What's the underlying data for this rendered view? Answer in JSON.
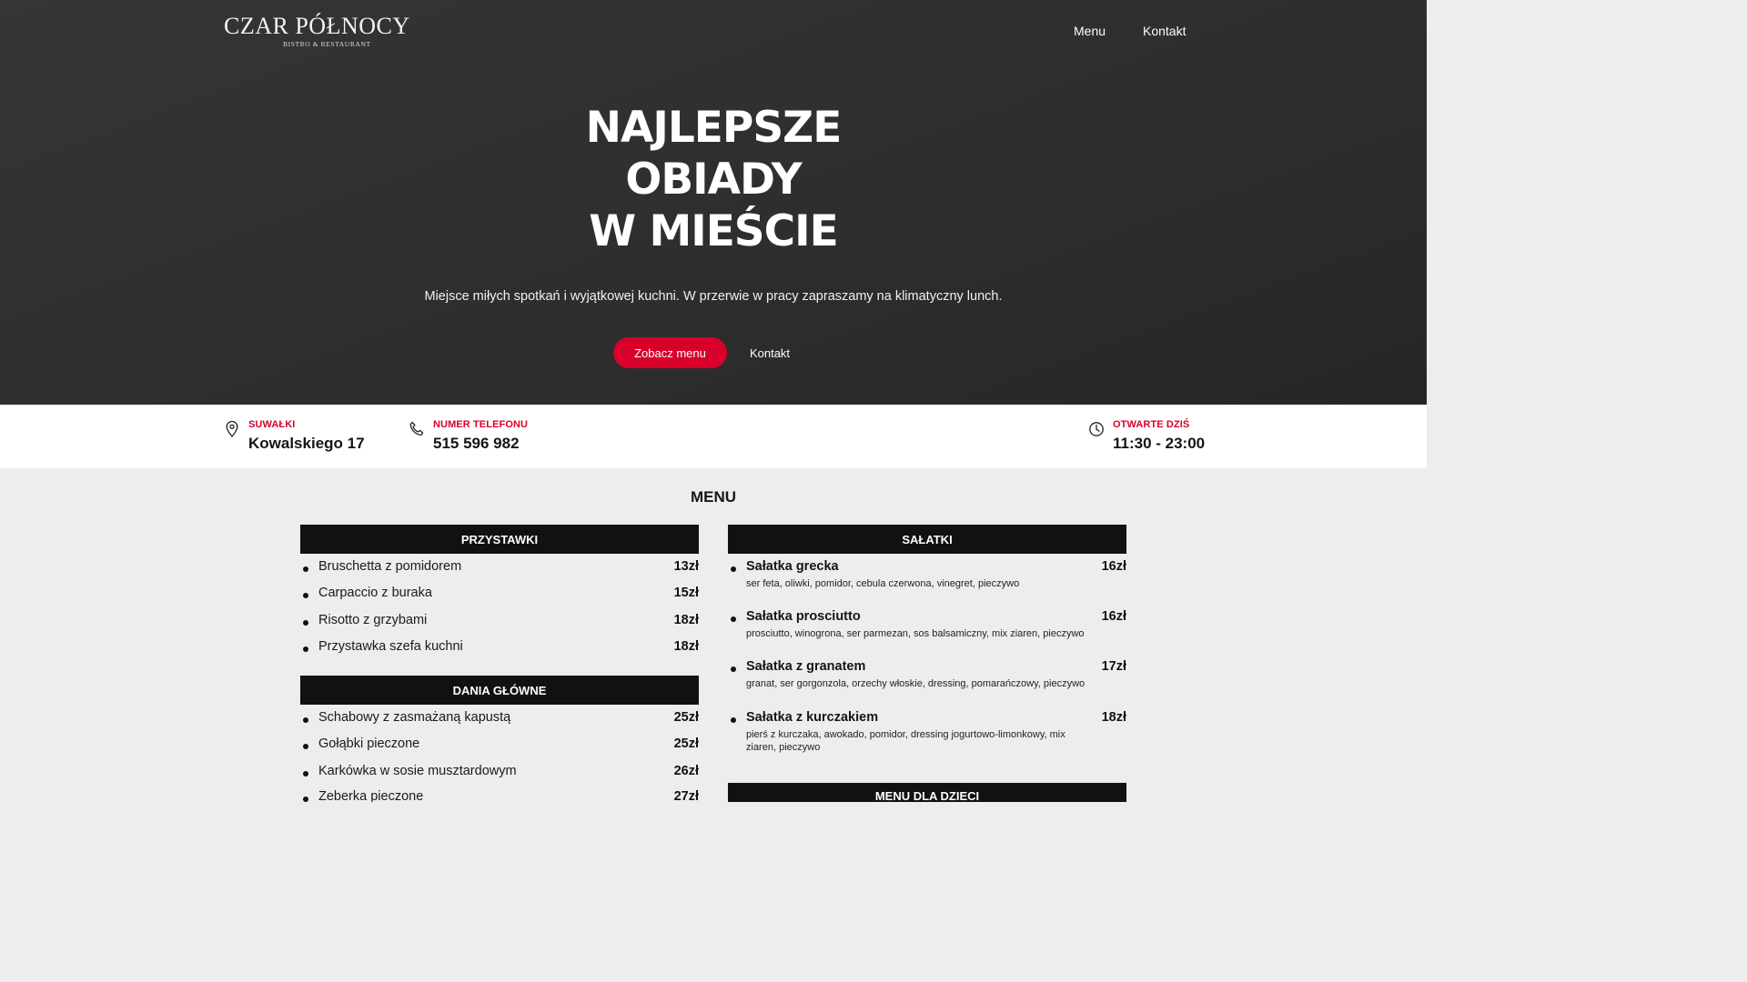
{
  "brand": {
    "name": "CZAR PÓŁNOCY",
    "tagline": "BISTRO & RESTAURANT"
  },
  "nav": {
    "menu": "Menu",
    "contact": "Kontakt"
  },
  "hero": {
    "title_lines": [
      "NAJLEPSZE",
      "OBIADY",
      "W MIEŚCIE"
    ],
    "subtitle": "Miejsce miłych spotkań i wyjątkowej kuchni. W przerwie w pracy zapraszamy na klimatyczny lunch.",
    "primary_button": "Zobacz menu",
    "secondary_button": "Kontakt"
  },
  "info": {
    "address_label": "SUWAŁKI",
    "address_value": "Kowalskiego 17",
    "phone_label": "NUMER TELEFONU",
    "phone_value": "515 596 982",
    "hours_label": "OTWARTE DZIŚ",
    "hours_value": "11:30 - 23:00",
    "icons": [
      "location-pin-icon",
      "phone-icon",
      "clock-icon"
    ]
  },
  "menu": {
    "heading": "MENU",
    "starters": {
      "title": "PRZYSTAWKI",
      "items": [
        {
          "name": "Bruschetta z pomidorem",
          "price": "13zł"
        },
        {
          "name": "Carpaccio z buraka",
          "price": "15zł"
        },
        {
          "name": "Risotto z grzybami",
          "price": "18zł"
        },
        {
          "name": "Przystawka szefa kuchni",
          "price": "18zł"
        }
      ]
    },
    "mains": {
      "title": "DANIA GŁÓWNE",
      "items": [
        {
          "name": "Schabowy z zasmażaną kapustą",
          "price": "25zł"
        },
        {
          "name": "Gołąbki pieczone",
          "price": "25zł"
        },
        {
          "name": "Karkówka w sosie musztardowym",
          "price": "26zł"
        },
        {
          "name": "Żeberka pieczone",
          "price": "27zł"
        }
      ]
    },
    "salads": {
      "title": "SAŁATKI",
      "items": [
        {
          "name": "Sałatka grecka",
          "price": "16zł",
          "desc": "ser feta, oliwki, pomidor, cebula czerwona, vinegret, pieczywo"
        },
        {
          "name": "Sałatka prosciutto",
          "price": "16zł",
          "desc": "prosciutto, winogrona, ser parmezan, sos balsamiczny, mix ziaren, pieczywo"
        },
        {
          "name": "Sałatka z granatem",
          "price": "17zł",
          "desc": "granat, ser gorgonzola, orzechy włoskie, dressing, pomarańczowy, pieczywo"
        },
        {
          "name": "Sałatka z kurczakiem",
          "price": "18zł",
          "desc": "pierś z kurczaka, awokado, pomidor, dressing jogurtowo-limonkowy, mix ziaren, pieczywo"
        }
      ]
    },
    "kids": {
      "title": "MENU DLA DZIECI"
    }
  },
  "colors": {
    "accent": "#d8002a",
    "hero_bg": "#2e2e2e",
    "category_bar": "#111111",
    "page_bg": "#ededed"
  }
}
